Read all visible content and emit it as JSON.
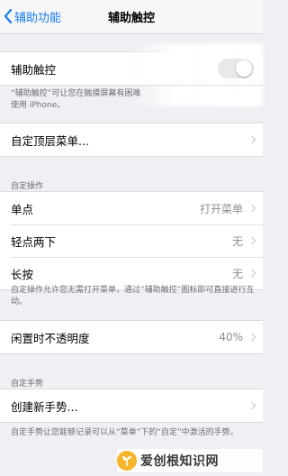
{
  "nav": {
    "back_label": "辅助功能",
    "title": "辅助触控"
  },
  "assistive_touch": {
    "label": "辅助触控",
    "enabled": false,
    "footer": "“辅助触控”可让您在触摸屏幕有困难",
    "footer_line2": "使用 iPhone。"
  },
  "top_menu": {
    "label": "自定顶层菜单..."
  },
  "custom_actions": {
    "header": "自定操作",
    "items": [
      {
        "label": "单点",
        "value": "打开菜单"
      },
      {
        "label": "轻点两下",
        "value": "无"
      },
      {
        "label": "长按",
        "value": "无"
      }
    ],
    "footer": "自定操作允许您无需打开菜单，通过“辅助触控”图标即可直接进行互动。"
  },
  "idle_opacity": {
    "label": "闲置时不透明度",
    "value": "40%"
  },
  "custom_gestures": {
    "header": "自定手势",
    "create_label": "创建新手势...",
    "footer": "自定手势让您能够记录可以从“菜单”下的“自定”中激活的手势。"
  },
  "watermark": {
    "text": "爱创根知识网"
  },
  "colors": {
    "accent": "#1a7cf5",
    "background": "#efeff4",
    "secondary_text": "#8e8e93"
  }
}
